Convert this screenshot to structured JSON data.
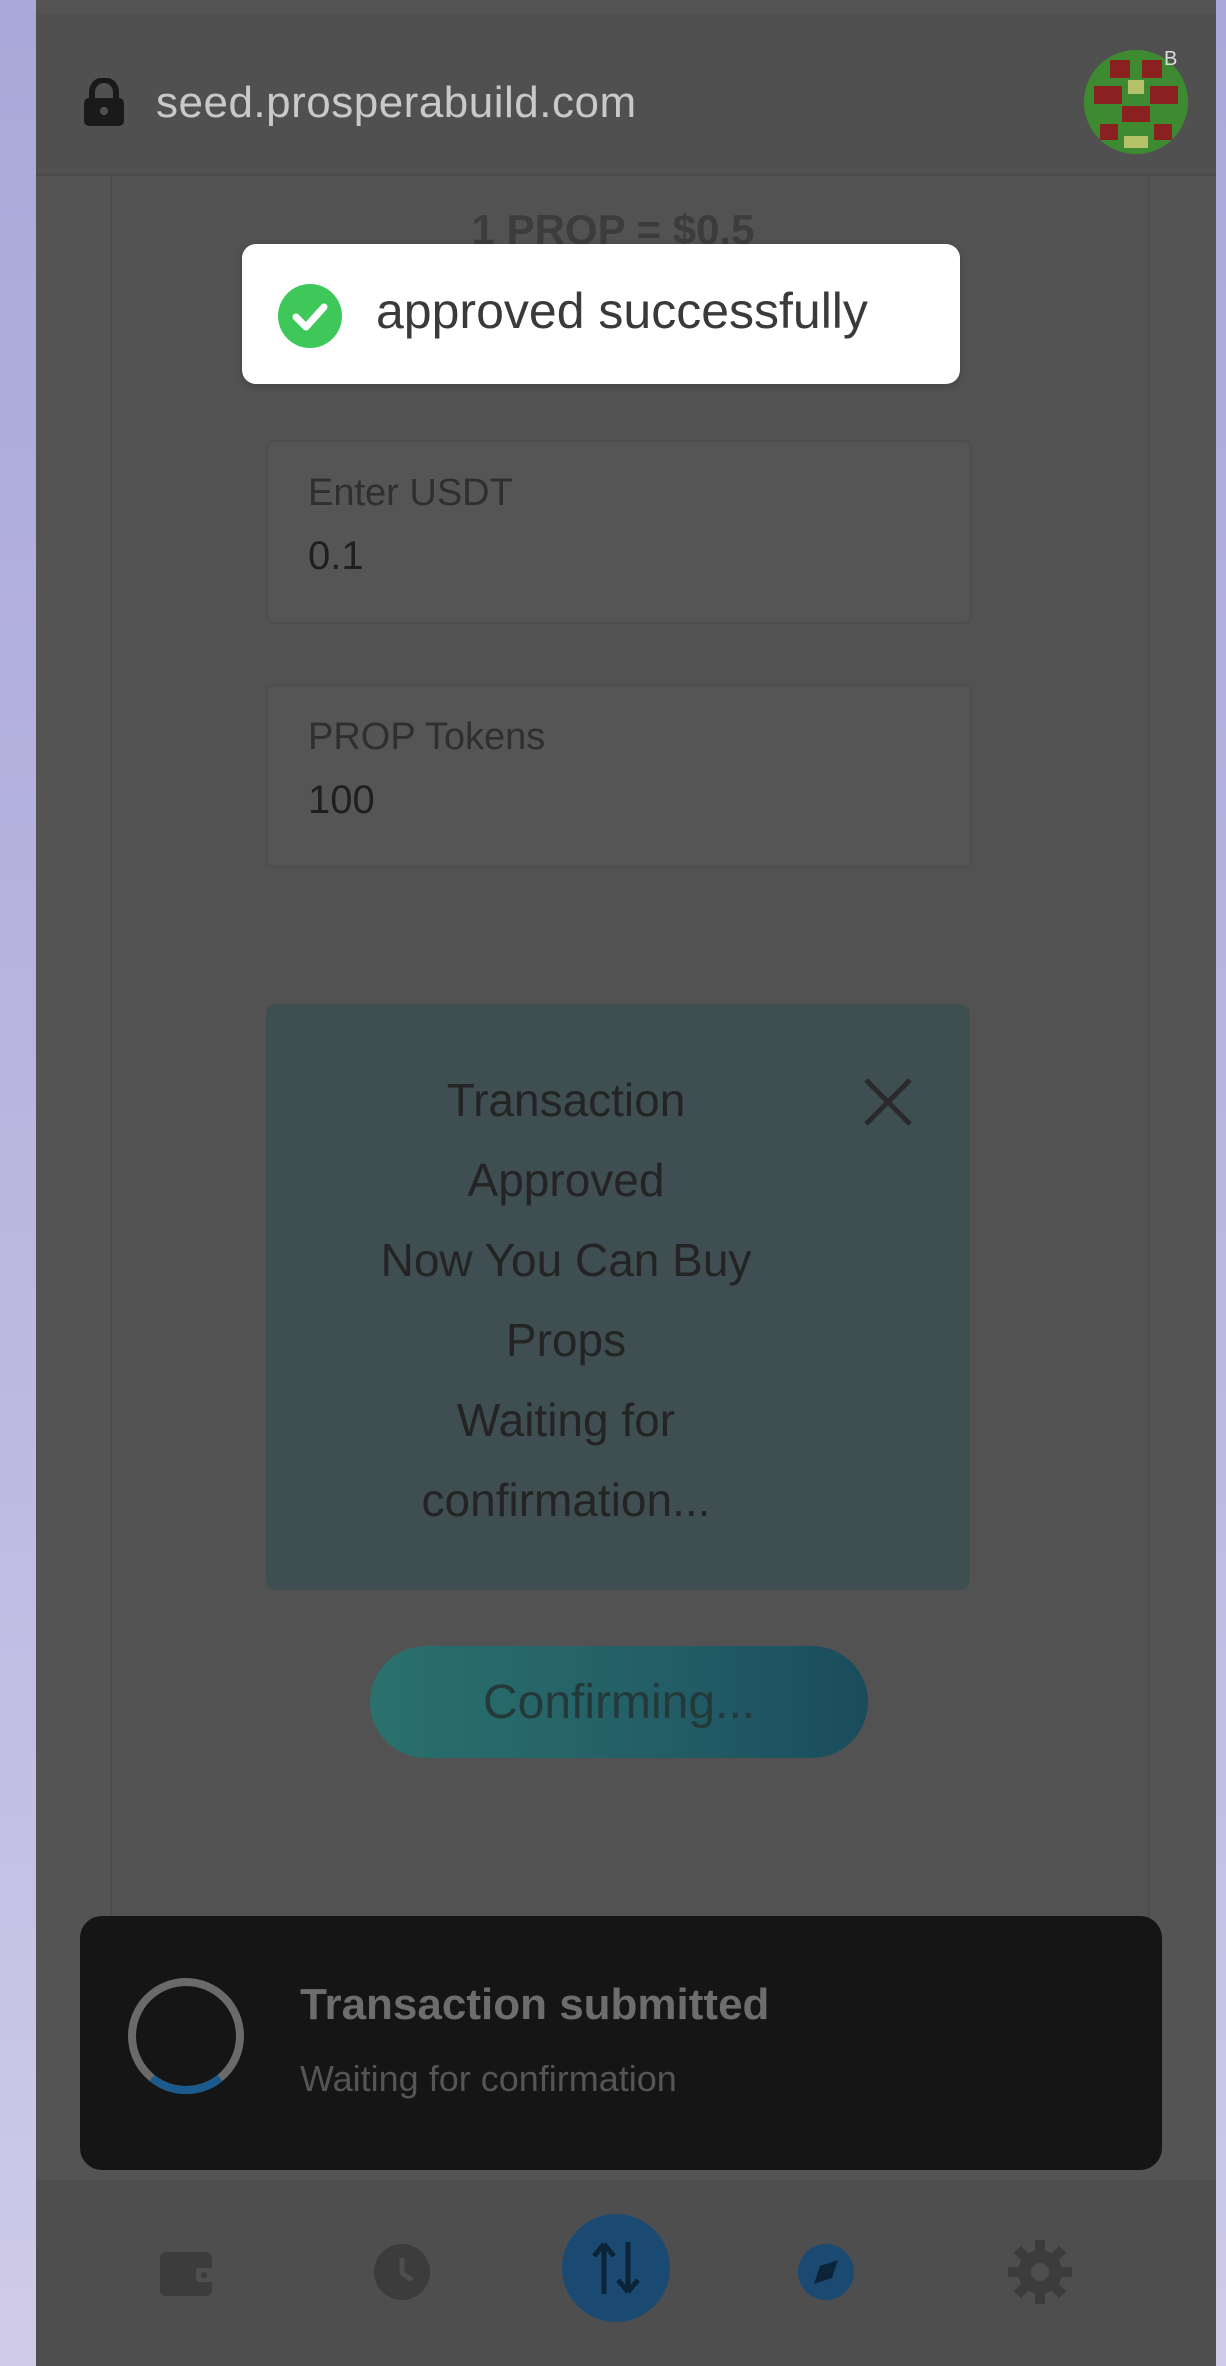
{
  "browser": {
    "url": "seed.prosperabuild.com",
    "avatar_badge": "B"
  },
  "rate": {
    "text": "1 PROP = $0.5"
  },
  "form": {
    "usdt_label": "Enter USDT",
    "usdt_value": "0.1",
    "prop_label": "PROP Tokens",
    "prop_value": "100"
  },
  "tx_panel": {
    "message": "Transaction\nApproved\nNow You Can Buy\nProps\nWaiting for\nconfirmation..."
  },
  "confirm_button": {
    "label": "Confirming..."
  },
  "toast": {
    "message": "approved successfully"
  },
  "snackbar": {
    "title": "Transaction submitted",
    "subtitle": "Waiting for confirmation"
  },
  "bottom_nav": {
    "items": [
      "wallet-icon",
      "clock-icon",
      "swap-icon",
      "compass-icon",
      "settings-icon"
    ],
    "active": "swap-icon"
  },
  "colors": {
    "accent": "#1a5a8c",
    "success": "#3fc85a",
    "panel": "#3f4e50"
  }
}
